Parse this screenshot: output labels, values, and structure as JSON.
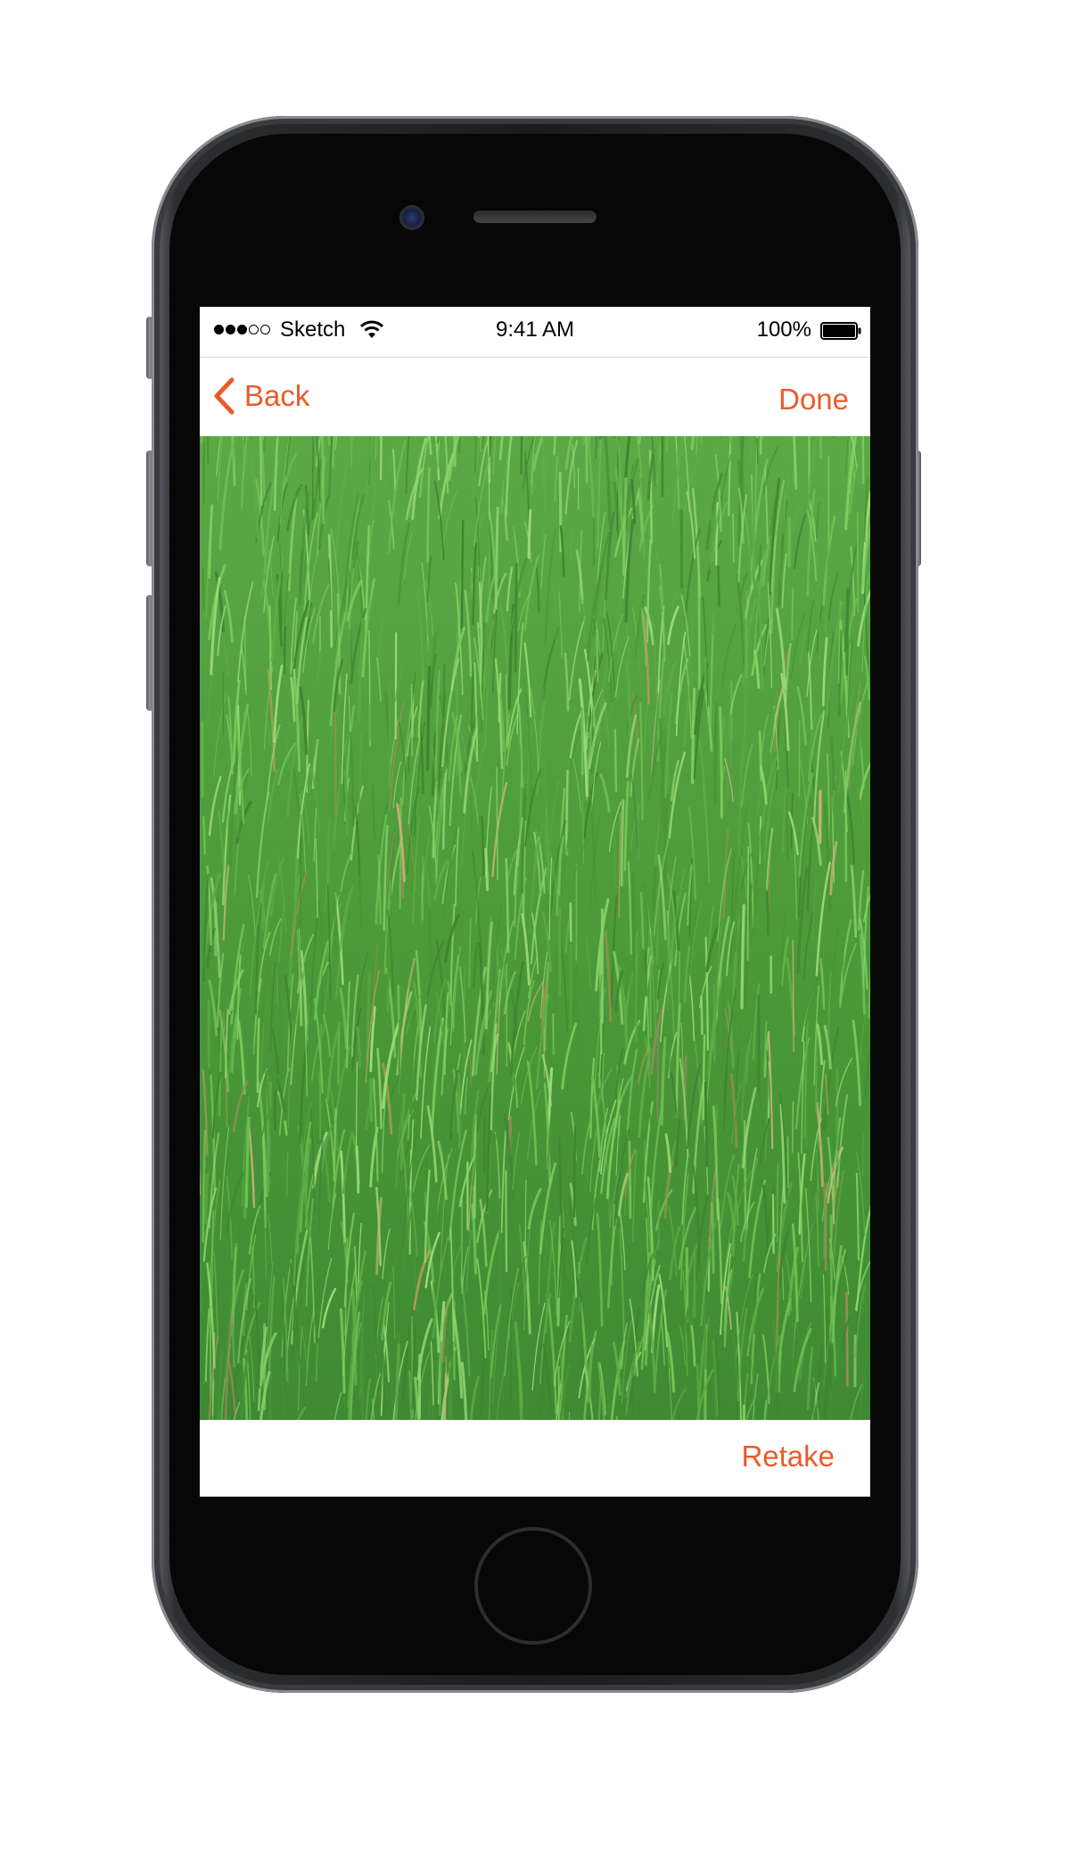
{
  "status_bar": {
    "carrier": "Sketch",
    "signal_bars_filled": 3,
    "signal_bars_total": 5,
    "time": "9:41 AM",
    "battery_percent": "100%",
    "battery_level": 1.0
  },
  "nav": {
    "back_label": "Back",
    "done_label": "Done"
  },
  "photo": {
    "subject_icon": "grass-photo"
  },
  "footer": {
    "retake_label": "Retake"
  },
  "colors": {
    "accent": "#ea5b2a",
    "grass_base": "#4f9a3b",
    "grass_light": "#7cc95c",
    "grass_dry": "#b69a5a"
  }
}
